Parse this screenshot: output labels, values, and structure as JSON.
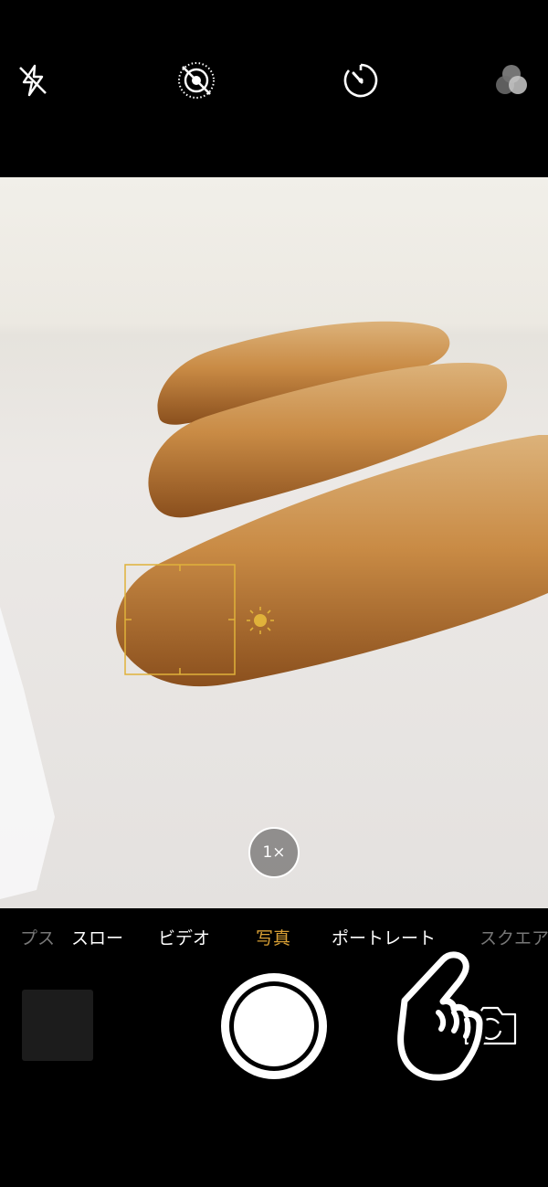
{
  "top_controls": {
    "icons": [
      "flash-off-icon",
      "live-photo-off-icon",
      "timer-icon",
      "filters-icon"
    ]
  },
  "viewfinder": {
    "zoom_label": "1×",
    "focus_box": true,
    "exposure_icon": "sun-icon"
  },
  "modes": {
    "items": [
      "プス",
      "スロー",
      "ビデオ",
      "写真",
      "ポートレート",
      "スクエア"
    ],
    "active": "写真"
  },
  "colors": {
    "accent": "#d9a035",
    "background": "#000000",
    "foreground": "#ffffff"
  }
}
